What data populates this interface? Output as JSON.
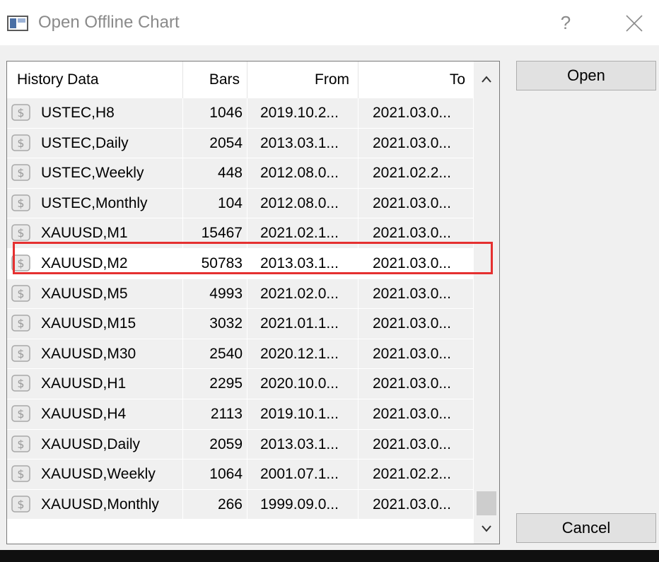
{
  "window": {
    "title": "Open Offline Chart",
    "help_label": "?",
    "close_icon": "close-icon"
  },
  "table": {
    "headers": [
      "History Data",
      "Bars",
      "From",
      "To"
    ],
    "rows": [
      {
        "name": "USTEC,H8",
        "bars": "1046",
        "from": "2019.10.2...",
        "to": "2021.03.0..."
      },
      {
        "name": "USTEC,Daily",
        "bars": "2054",
        "from": "2013.03.1...",
        "to": "2021.03.0..."
      },
      {
        "name": "USTEC,Weekly",
        "bars": "448",
        "from": "2012.08.0...",
        "to": "2021.02.2..."
      },
      {
        "name": "USTEC,Monthly",
        "bars": "104",
        "from": "2012.08.0...",
        "to": "2021.03.0..."
      },
      {
        "name": "XAUUSD,M1",
        "bars": "15467",
        "from": "2021.02.1...",
        "to": "2021.03.0..."
      },
      {
        "name": "XAUUSD,M2",
        "bars": "50783",
        "from": "2013.03.1...",
        "to": "2021.03.0..."
      },
      {
        "name": "XAUUSD,M5",
        "bars": "4993",
        "from": "2021.02.0...",
        "to": "2021.03.0..."
      },
      {
        "name": "XAUUSD,M15",
        "bars": "3032",
        "from": "2021.01.1...",
        "to": "2021.03.0..."
      },
      {
        "name": "XAUUSD,M30",
        "bars": "2540",
        "from": "2020.12.1...",
        "to": "2021.03.0..."
      },
      {
        "name": "XAUUSD,H1",
        "bars": "2295",
        "from": "2020.10.0...",
        "to": "2021.03.0..."
      },
      {
        "name": "XAUUSD,H4",
        "bars": "2113",
        "from": "2019.10.1...",
        "to": "2021.03.0..."
      },
      {
        "name": "XAUUSD,Daily",
        "bars": "2059",
        "from": "2013.03.1...",
        "to": "2021.03.0..."
      },
      {
        "name": "XAUUSD,Weekly",
        "bars": "1064",
        "from": "2001.07.1...",
        "to": "2021.02.2..."
      },
      {
        "name": "XAUUSD,Monthly",
        "bars": "266",
        "from": "1999.09.0...",
        "to": "2021.03.0..."
      }
    ],
    "highlighted_row_index": 5,
    "row_icon": "dollar-icon"
  },
  "buttons": {
    "open_label": "Open",
    "cancel_label": "Cancel"
  },
  "colors": {
    "highlight": "#e53030",
    "row_bg": "#f0f0f0",
    "window_bg": "#f0f0f0"
  }
}
